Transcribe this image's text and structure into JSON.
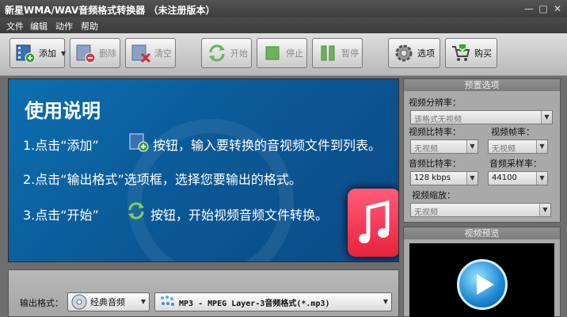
{
  "window": {
    "title": "新星WMA/WAV音频格式转换器 （未注册版本）"
  },
  "menu": [
    "文件",
    "编辑",
    "动作",
    "帮助"
  ],
  "toolbar": {
    "add_label": "添加",
    "delete_label": "删除",
    "clear_label": "清空",
    "start_label": "开始",
    "stop_label": "停止",
    "pause_label": "暂停",
    "options_label": "选项",
    "buy_label": "购买"
  },
  "instructions": {
    "title": "使用说明",
    "lines": [
      "1.点击“添加”",
      "按钮，输入要转换的音视频文件到列表。",
      "2.点击“输出格式”选项框，选择您要输出的格式。",
      "3.点击“开始”",
      "按钮，开始视频音频文件转换。"
    ]
  },
  "output": {
    "label": "输出格式：",
    "category": "经典音频",
    "format": "MP3 - MPEG Layer-3音频格式(*.mp3)"
  },
  "settings": {
    "title": "预置选项",
    "video_resolution_label": "视频分辨率：",
    "video_resolution_value": "该格式无视频",
    "video_bitrate_label": "视频比特率：",
    "video_bitrate_value": "无视频",
    "video_framerate_label": "视频帧率：",
    "video_framerate_value": "无视频",
    "audio_bitrate_label": "音频比特率：",
    "audio_bitrate_value": "128 kbps",
    "audio_samplerate_label": "音频采样率：",
    "audio_samplerate_value": "44100",
    "video_scale_label": "视频缩放：",
    "video_scale_value": "无视频"
  },
  "preview": {
    "title": "视频预览"
  },
  "colors": {
    "banner_blue": "#0b5a98",
    "panel_gray": "#a9a9a9",
    "toolbar_gray": "#c9c9c9"
  }
}
